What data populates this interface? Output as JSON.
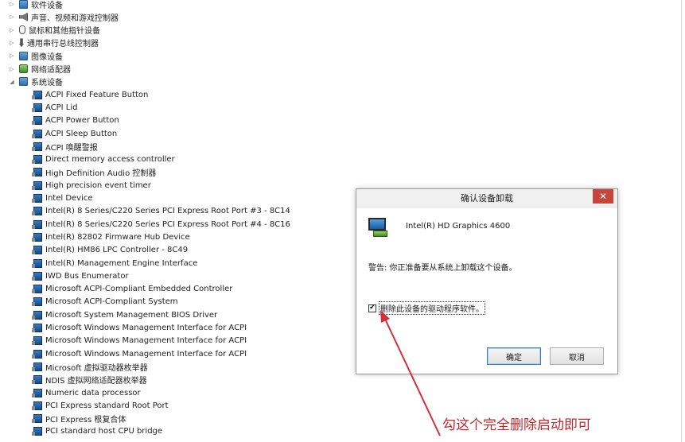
{
  "tree": {
    "categories": [
      {
        "label": "软件设备",
        "expander": "▷",
        "icon": "software-device-icon"
      },
      {
        "label": "声音、视频和游戏控制器",
        "expander": "▷",
        "icon": "speaker-icon"
      },
      {
        "label": "鼠标和其他指针设备",
        "expander": "▷",
        "icon": "mouse-icon"
      },
      {
        "label": "通用串行总线控制器",
        "expander": "▷",
        "icon": "usb-icon"
      },
      {
        "label": "图像设备",
        "expander": "▷",
        "icon": "camera-icon"
      },
      {
        "label": "网络适配器",
        "expander": "▷",
        "icon": "network-adapter-icon"
      },
      {
        "label": "系统设备",
        "expander": "◢",
        "icon": "system-device-icon"
      }
    ],
    "system_devices": [
      "ACPI Fixed Feature Button",
      "ACPI Lid",
      "ACPI Power Button",
      "ACPI Sleep Button",
      "ACPI 唤醒警报",
      "Direct memory access controller",
      "High Definition Audio 控制器",
      "High precision event timer",
      "Intel Device",
      "Intel(R) 8 Series/C220 Series PCI Express Root Port #3 - 8C14",
      "Intel(R) 8 Series/C220 Series PCI Express Root Port #4 - 8C16",
      "Intel(R) 82802 Firmware Hub Device",
      "Intel(R) HM86 LPC Controller - 8C49",
      "Intel(R) Management Engine Interface",
      "IWD Bus Enumerator",
      "Microsoft ACPI-Compliant Embedded Controller",
      "Microsoft ACPI-Compliant System",
      "Microsoft System Management BIOS Driver",
      "Microsoft Windows Management Interface for ACPI",
      "Microsoft Windows Management Interface for ACPI",
      "Microsoft Windows Management Interface for ACPI",
      "Microsoft 虚拟驱动器枚举器",
      "NDIS 虚拟网络适配器枚举器",
      "Numeric data processor",
      "PCI Express standard Root Port",
      "PCI Express 根复合体",
      "PCI standard host CPU bridge"
    ]
  },
  "dialog": {
    "title": "确认设备卸载",
    "close_label": "✕",
    "device_name": "Intel(R) HD Graphics 4600",
    "warning": "警告: 你正准备要从系统上卸载这个设备。",
    "checkbox_label": "删除此设备的驱动程序软件。",
    "checkbox_checked": true,
    "checkbox_mark": "✔",
    "ok_label": "确定",
    "cancel_label": "取消"
  },
  "annotation": {
    "text": "勾这个完全删除启动即可",
    "color": "#c0282d"
  }
}
